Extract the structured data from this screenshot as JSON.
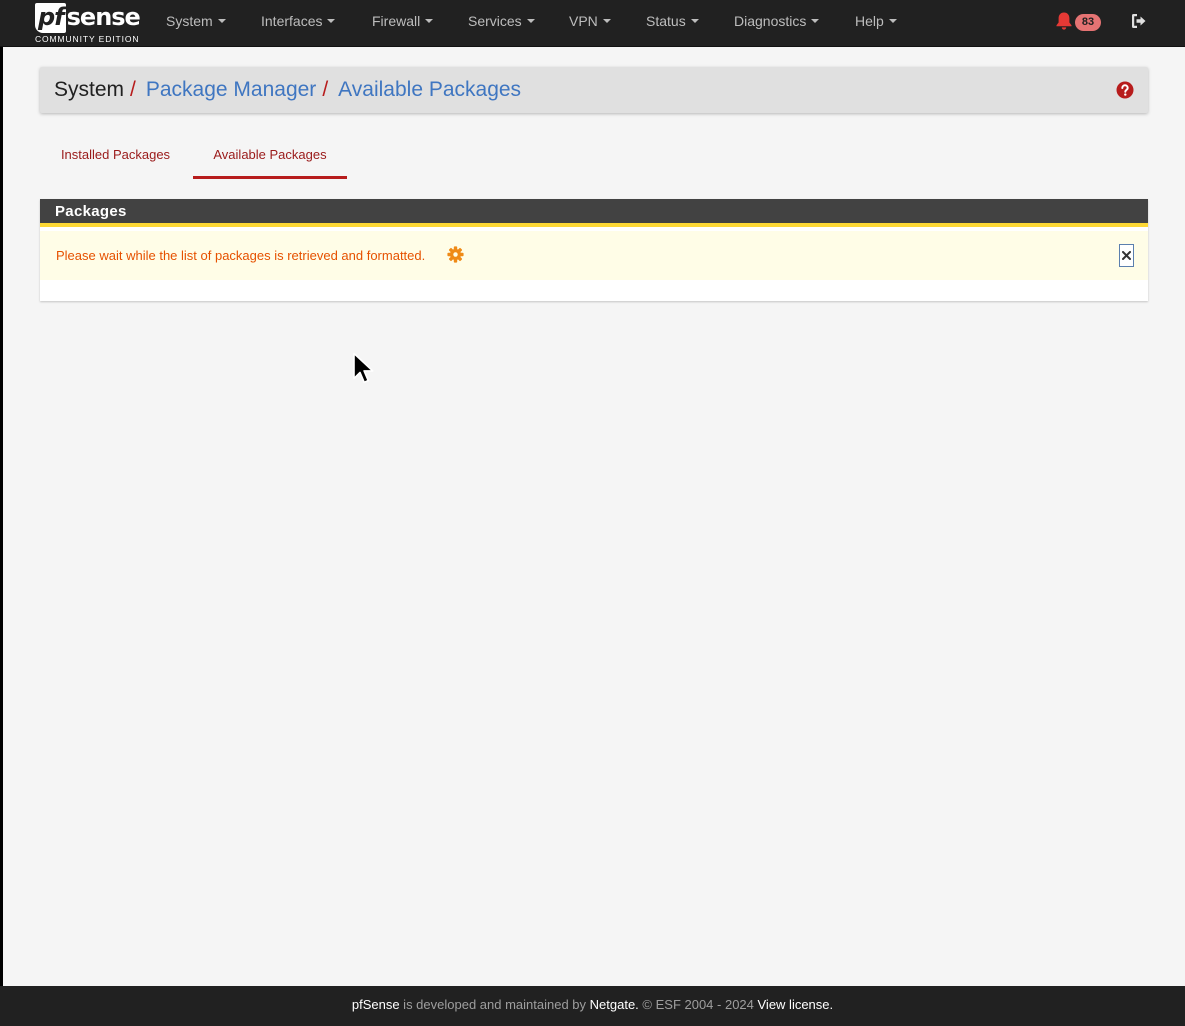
{
  "brand": {
    "logo_pf": "pf",
    "logo_sense": "sense",
    "edition": "COMMUNITY EDITION"
  },
  "nav": {
    "items": [
      {
        "label": "System"
      },
      {
        "label": "Interfaces"
      },
      {
        "label": "Firewall"
      },
      {
        "label": "Services"
      },
      {
        "label": "VPN"
      },
      {
        "label": "Status"
      },
      {
        "label": "Diagnostics"
      },
      {
        "label": "Help"
      }
    ],
    "notification_count": "83"
  },
  "breadcrumb": {
    "root": "System",
    "separator": "/",
    "level1": "Package Manager",
    "level2": "Available Packages"
  },
  "tabs": [
    {
      "label": "Installed Packages",
      "active": false
    },
    {
      "label": "Available Packages",
      "active": true
    }
  ],
  "panel": {
    "title": "Packages",
    "alert_message": "Please wait while the list of packages is retrieved and formatted."
  },
  "footer": {
    "product": "pfSense",
    "text1": " is developed and maintained by ",
    "company": "Netgate.",
    "text2": " © ESF 2004 - 2024 ",
    "license_link": "View license."
  },
  "colors": {
    "navbar": "#212121",
    "link_blue": "#3f76c1",
    "accent_red": "#b71c1c",
    "alert_orange": "#e65100",
    "alert_bg": "#fffde7",
    "panel_rule": "#fdd835"
  }
}
